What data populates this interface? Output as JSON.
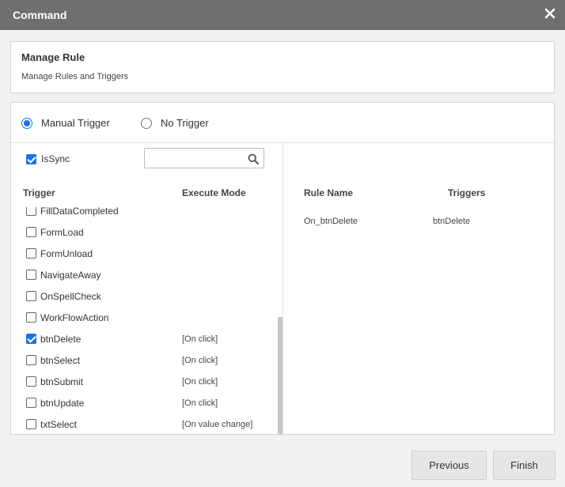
{
  "dialog": {
    "title": "Command"
  },
  "header": {
    "title": "Manage Rule",
    "subtitle": "Manage Rules and Triggers"
  },
  "trigger_options": [
    {
      "label": "Manual Trigger",
      "selected": true
    },
    {
      "label": "No Trigger",
      "selected": false
    }
  ],
  "issync": {
    "label": "IsSync",
    "checked": true
  },
  "search": {
    "value": "",
    "placeholder": ""
  },
  "left_columns": {
    "trigger": "Trigger",
    "execute_mode": "Execute Mode"
  },
  "triggers": [
    {
      "name": "FillDataCompleted",
      "mode": "",
      "checked": false
    },
    {
      "name": "FormLoad",
      "mode": "",
      "checked": false
    },
    {
      "name": "FormUnload",
      "mode": "",
      "checked": false
    },
    {
      "name": "NavigateAway",
      "mode": "",
      "checked": false
    },
    {
      "name": "OnSpellCheck",
      "mode": "",
      "checked": false
    },
    {
      "name": "WorkFlowAction",
      "mode": "",
      "checked": false
    },
    {
      "name": "btnDelete",
      "mode": "[On click]",
      "checked": true
    },
    {
      "name": "btnSelect",
      "mode": "[On click]",
      "checked": false
    },
    {
      "name": "btnSubmit",
      "mode": "[On click]",
      "checked": false
    },
    {
      "name": "btnUpdate",
      "mode": "[On click]",
      "checked": false
    },
    {
      "name": "txtSelect",
      "mode": "[On value change]",
      "checked": false
    }
  ],
  "right_columns": {
    "rule_name": "Rule Name",
    "triggers": "Triggers"
  },
  "rules": [
    {
      "rule_name": "On_btnDelete",
      "triggers": "btnDelete"
    }
  ],
  "footer": {
    "previous_label": "Previous",
    "finish_label": "Finish"
  },
  "colors": {
    "titlebar": "#6f6f6f",
    "accent": "#1a73e8",
    "button_bg": "#e6e6e6"
  }
}
